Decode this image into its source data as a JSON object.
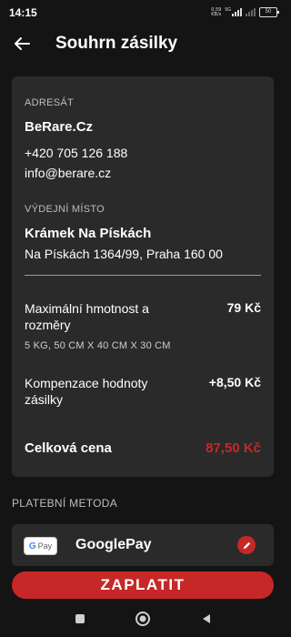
{
  "status_bar": {
    "time": "14:15",
    "net_speed_value": "0,59",
    "net_speed_unit": "KB/s",
    "network_type": "5G",
    "battery_level": "50"
  },
  "header": {
    "title": "Souhrn zásilky"
  },
  "recipient": {
    "section_label": "ADRESÁT",
    "name": "BeRare.Cz",
    "phone": "+420 705 126 188",
    "email": "info@berare.cz"
  },
  "pickup": {
    "section_label": "VÝDEJNÍ MÍSTO",
    "name": "Krámek Na Pískách",
    "address": "Na Pískách 1364/99, Praha 160 00"
  },
  "items": [
    {
      "label": "Maximální hmotnost a rozměry",
      "value": "79 Kč",
      "sub": "5 KG, 50 CM X 40 CM X 30 CM"
    },
    {
      "label": "Kompenzace hodnoty zásilky",
      "value": "+8,50 Kč"
    }
  ],
  "total": {
    "label": "Celková cena",
    "value": "87,50 Kč"
  },
  "payment": {
    "section_label": "PLATEBNÍ METODA",
    "badge_g": "G",
    "badge_pay": "Pay",
    "method_name": "GooglePay"
  },
  "pay_button": {
    "label": "ZAPLATIT"
  },
  "icons": {
    "back": "arrow-left-icon",
    "edit": "pencil-icon",
    "nav_recents": "square-icon",
    "nav_home": "circle-icon",
    "nav_back": "triangle-icon"
  },
  "colors": {
    "accent": "#c62828",
    "background": "#141414",
    "card": "#2a2a2a"
  }
}
